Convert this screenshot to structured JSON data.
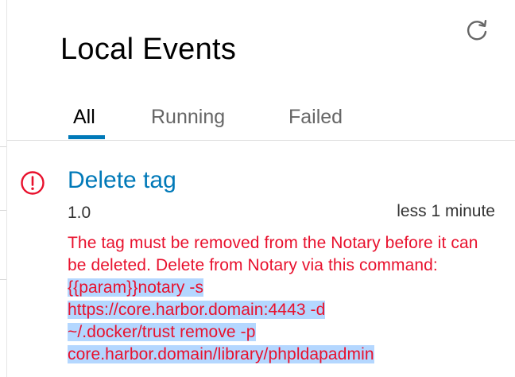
{
  "page": {
    "title": "Local Events"
  },
  "icons": {
    "refresh": "refresh-icon",
    "error": "error-circle-icon"
  },
  "tabs": [
    {
      "label": "All",
      "active": true
    },
    {
      "label": "Running",
      "active": false
    },
    {
      "label": "Failed",
      "active": false
    }
  ],
  "event": {
    "title": "Delete tag",
    "version": "1.0",
    "time": "less 1 minute",
    "message_prefix": "The tag must be removed from the Notary before it can be deleted. Delete from Notary via this command: ",
    "message_selected_lines": [
      "{{param}}notary -s",
      "https://core.harbor.domain:4443 -d",
      "~/.docker/trust remove -p",
      "core.harbor.domain/library/phpldapadmin"
    ]
  },
  "colors": {
    "accent": "#0079b8",
    "error": "#e8112d",
    "selection": "#b4d7ff"
  }
}
